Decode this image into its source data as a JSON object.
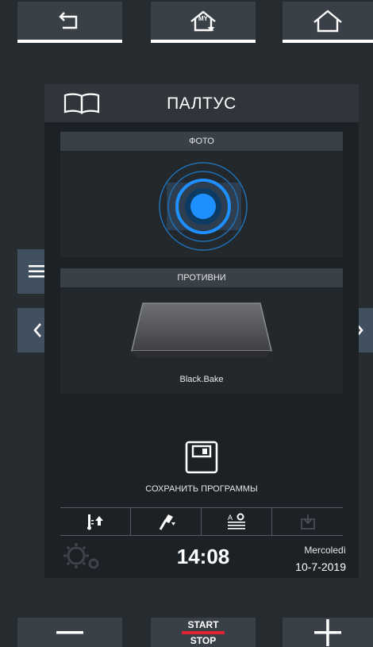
{
  "top_nav": {
    "back_icon": "back-arrow-icon",
    "my_home_badge": "MY",
    "my_home_icon": "my-home-icon",
    "home_icon": "home-icon"
  },
  "program": {
    "book_icon": "book-icon",
    "title": "ПАЛТУС"
  },
  "photo_section": {
    "title": "ФОТО"
  },
  "trays_section": {
    "title": "ПРОТИВНИ",
    "tray_name": "Black.Bake"
  },
  "save": {
    "label": "СОХРАНИТЬ ПРОГРАММЫ",
    "icon": "floppy-disk-icon"
  },
  "toolbar": {
    "icons": [
      "temperature-up-icon",
      "probe-icon",
      "text-settings-icon",
      "download-disabled-icon"
    ]
  },
  "status": {
    "time": "14:08",
    "day": "Mercoledì",
    "date": "10-7-2019",
    "settings_icon": "gears-icon"
  },
  "bottom_bar": {
    "start_label": "START",
    "stop_label": "STOP",
    "minus_icon": "minus-icon",
    "plus_icon": "plus-icon"
  },
  "colors": {
    "background": "#272c31",
    "panel": "#1c2126",
    "accent_blue": "#1e90ff",
    "start_stop_red": "#e0242f",
    "side_tab": "#41505e"
  }
}
